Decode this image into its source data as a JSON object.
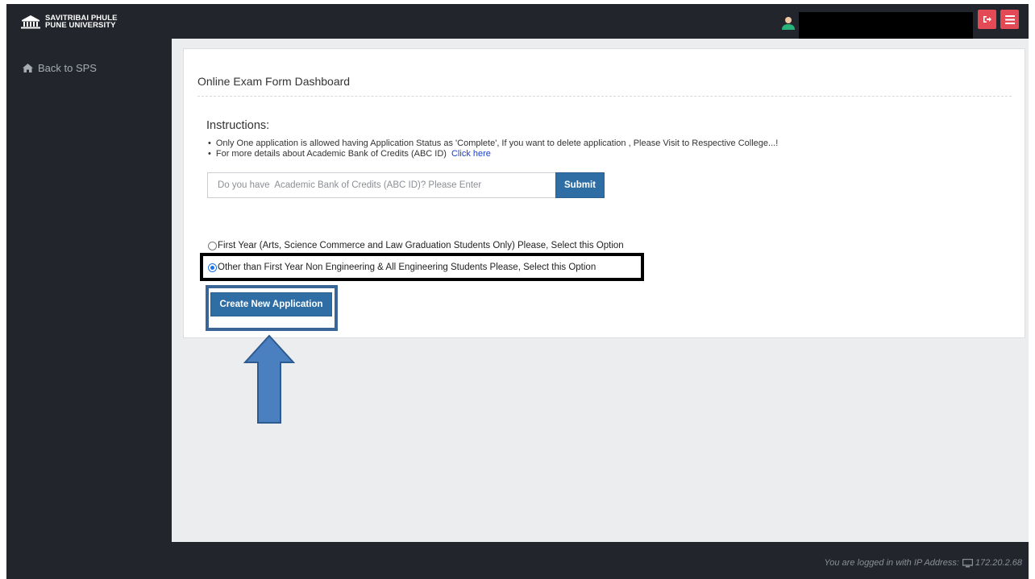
{
  "header": {
    "brand_line1": "SAVITRIBAI PHULE",
    "brand_line2": "PUNE UNIVERSITY",
    "user_icon": "user-avatar-icon",
    "logout_icon": "sign-out-icon",
    "menu_icon": "hamburger-menu-icon",
    "button_color": "#e44a55"
  },
  "sidebar": {
    "items": [
      {
        "label": "Back to SPS",
        "icon": "home-icon"
      }
    ]
  },
  "main": {
    "title": "Online Exam Form Dashboard",
    "instructions_heading": "Instructions:",
    "instructions": [
      "Only One application is allowed having Application Status as 'Complete', If you want to delete application , Please Visit to Respective College...!",
      "For more details about Academic Bank of Credits (ABC ID)"
    ],
    "abc_link_label": "Click here",
    "abc_input_placeholder": "Do you have  Academic Bank of Credits (ABC ID)? Please Enter",
    "abc_input_value": "",
    "submit_label": "Submit",
    "options": [
      {
        "label": "First Year (Arts, Science Commerce and Law Graduation Students Only) Please, Select this Option",
        "selected": false
      },
      {
        "label": "Other than First Year Non Engineering & All Engineering Students Please, Select this Option",
        "selected": true
      }
    ],
    "create_button_label": "Create New Application",
    "accent_color": "#2f6ea5"
  },
  "footer": {
    "text": "You are logged in with IP Address:",
    "ip": "172.20.2.68",
    "icon": "desktop-icon"
  }
}
